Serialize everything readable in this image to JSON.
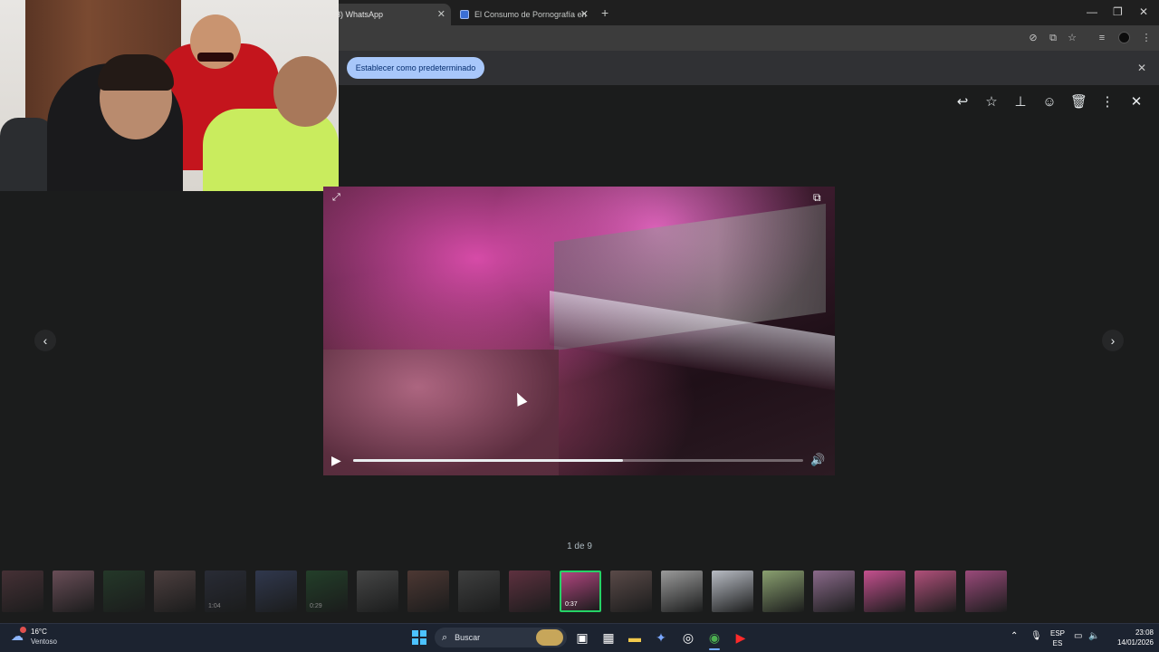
{
  "browser": {
    "tabs": [
      {
        "label": "(3) WhatsApp",
        "close": "✕"
      },
      {
        "label": "El Consumo de Pornografía en",
        "close": "✕"
      }
    ],
    "new_tab": "+",
    "window_controls": {
      "minimize": "—",
      "restore": "❐",
      "close": "✕"
    },
    "infobar": {
      "set_default_button": "Establecer como predeterminado",
      "close": "✕"
    }
  },
  "viewer": {
    "toolbar_icons": [
      "reply-icon",
      "star-icon",
      "pin-icon",
      "emoji-icon",
      "trash-icon",
      "more-icon",
      "close-icon"
    ],
    "toolbar_glyphs": {
      "reply": "↩",
      "star": "☆",
      "pin": "⊥",
      "emoji": "☺",
      "trash": "🗑",
      "more": "⋮",
      "close": "✕"
    },
    "video": {
      "play_glyph": "▶",
      "volume_glyph": "🔊",
      "progress": 0.6,
      "expand_glyph": "⤢",
      "popout_glyph": "⧉"
    },
    "nav": {
      "prev": "‹",
      "next": "›"
    },
    "counter": "1 de 9",
    "thumbnails": [
      {
        "dur": "",
        "dim": true,
        "color": "#7a4a55"
      },
      {
        "dur": "",
        "dim": true,
        "color": "#c98aa0"
      },
      {
        "dur": "",
        "dim": true,
        "color": "#2f5a38"
      },
      {
        "dur": "",
        "dim": true,
        "color": "#8a6a6a"
      },
      {
        "dur": "1:04",
        "dim": true,
        "color": "#3a3f55"
      },
      {
        "dur": "",
        "dim": true,
        "color": "#4a5a8a"
      },
      {
        "dur": "0:29",
        "dim": true,
        "color": "#2d6a3a"
      },
      {
        "dur": "",
        "dim": true,
        "color": "#7a7a7a"
      },
      {
        "dur": "",
        "dim": true,
        "color": "#8a5a50"
      },
      {
        "dur": "",
        "dim": true,
        "color": "#6a6a6a"
      },
      {
        "dur": "",
        "dim": true,
        "color": "#b04a6a"
      },
      {
        "dur": "0:37",
        "dim": false,
        "selected": true,
        "color": "#b0457e"
      },
      {
        "dur": "",
        "dim": false,
        "color": "#5a4a48"
      },
      {
        "dur": "",
        "dim": false,
        "color": "#9a9a9a"
      },
      {
        "dur": "",
        "dim": false,
        "color": "#b8bcc4"
      },
      {
        "dur": "",
        "dim": false,
        "color": "#8aa070"
      },
      {
        "dur": "",
        "dim": false,
        "color": "#8a6a8a"
      },
      {
        "dur": "",
        "dim": false,
        "color": "#c4508e"
      },
      {
        "dur": "",
        "dim": false,
        "color": "#b0507a"
      },
      {
        "dur": "",
        "dim": false,
        "color": "#9a4a7a"
      }
    ]
  },
  "taskbar": {
    "weather_temp": "16°C",
    "weather_desc": "Ventoso",
    "search_placeholder": "Buscar",
    "lang_top": "ESP",
    "lang_bottom": "ES",
    "time": "23:08",
    "date": "14/01/2026"
  },
  "colors": {
    "accent_green": "#25d366",
    "default_button": "#a8c7fa"
  }
}
